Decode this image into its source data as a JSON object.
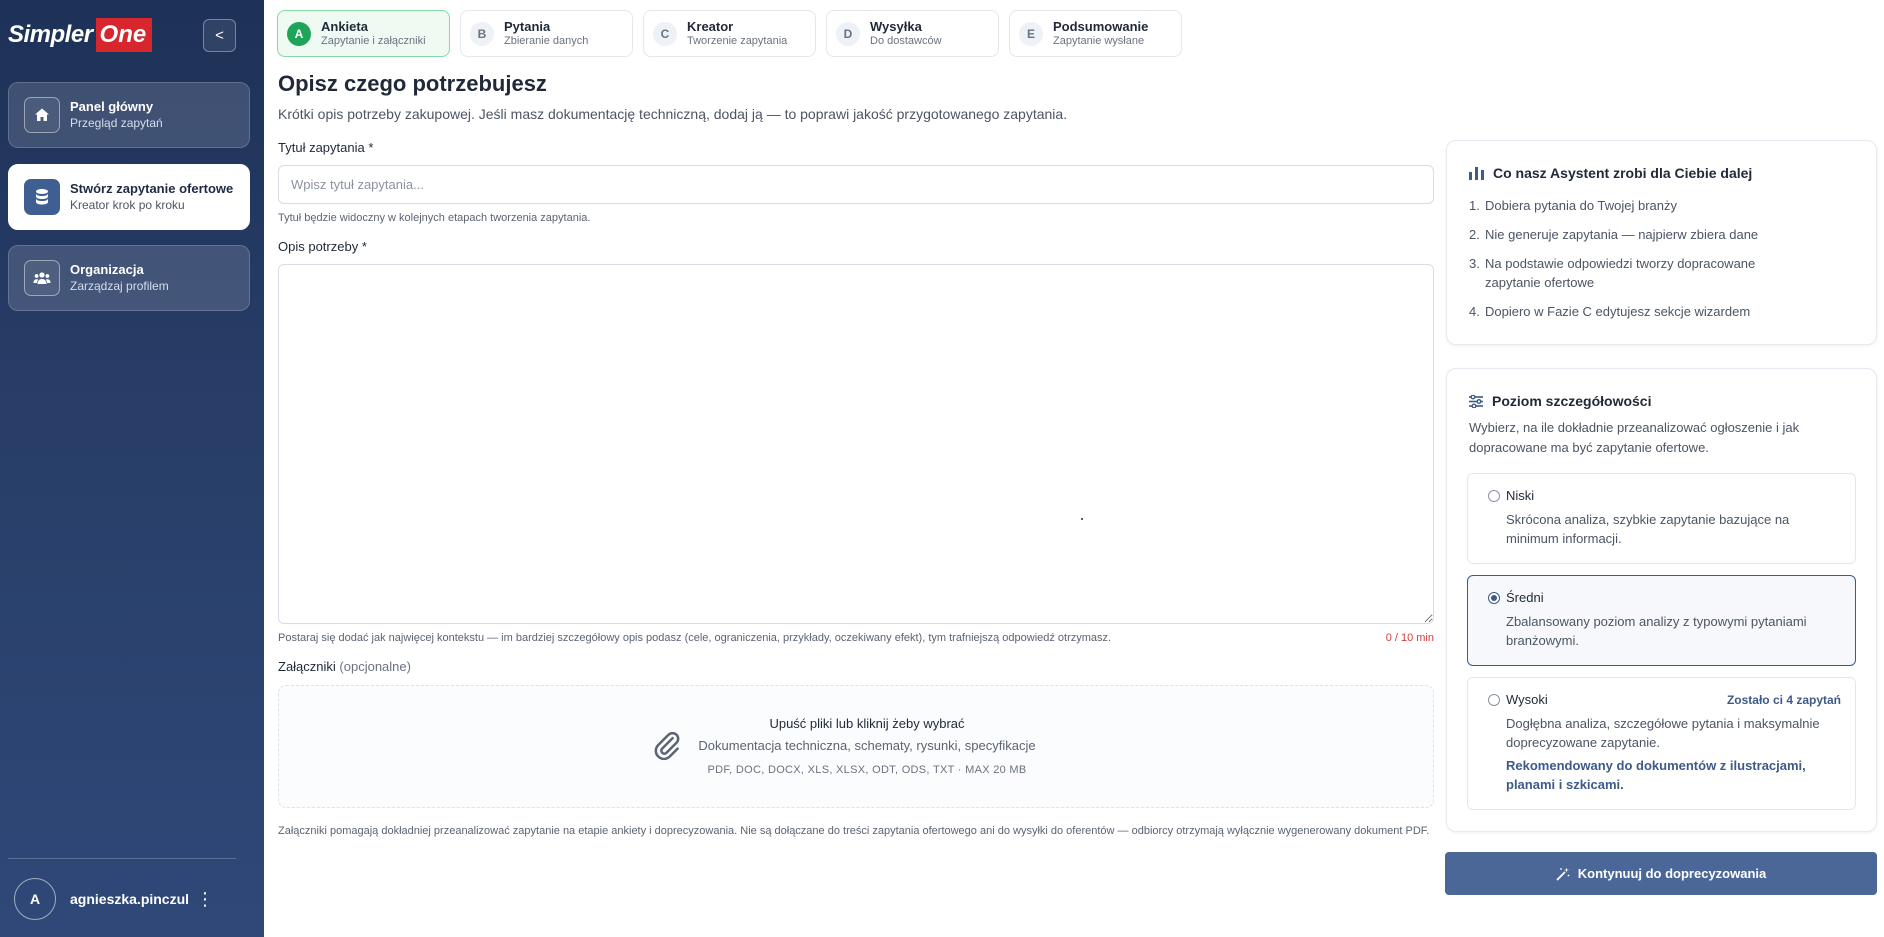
{
  "sidebar": {
    "logo_text": "Simpler",
    "logo_badge": "One",
    "collapse_label": "<",
    "items": [
      {
        "title": "Panel główny",
        "subtitle": "Przegląd zapytań"
      },
      {
        "title": "Stwórz zapytanie ofertowe",
        "subtitle": "Kreator krok po kroku"
      },
      {
        "title": "Organizacja",
        "subtitle": "Zarządzaj profilem"
      }
    ],
    "user": {
      "initial": "A",
      "name": "agnieszka.pinczuk@",
      "menu": "⋮"
    }
  },
  "steps": [
    {
      "letter": "A",
      "title": "Ankieta",
      "subtitle": "Zapytanie i załączniki"
    },
    {
      "letter": "B",
      "title": "Pytania",
      "subtitle": "Zbieranie danych"
    },
    {
      "letter": "C",
      "title": "Kreator",
      "subtitle": "Tworzenie zapytania"
    },
    {
      "letter": "D",
      "title": "Wysyłka",
      "subtitle": "Do dostawców"
    },
    {
      "letter": "E",
      "title": "Podsumowanie",
      "subtitle": "Zapytanie wysłane"
    }
  ],
  "main": {
    "title": "Opisz czego potrzebujesz",
    "description": "Krótki opis potrzeby zakupowej. Jeśli masz dokumentację techniczną, dodaj ją — to poprawi jakość przygotowanego zapytania.",
    "title_field": {
      "label": "Tytuł zapytania *",
      "placeholder": "Wpisz tytuł zapytania...",
      "value": "",
      "hint": "Tytuł będzie widoczny w kolejnych etapach tworzenia zapytania."
    },
    "need_field": {
      "label": "Opis potrzeby *",
      "value": "",
      "hint": "Postaraj się dodać jak najwięcej kontekstu — im bardziej szczegółowy opis podasz (cele, ograniczenia, przykłady, oczekiwany efekt), tym trafniejszą odpowiedź otrzymasz.",
      "counter": "0 / 10 min"
    },
    "attachments": {
      "label": "Załączniki",
      "optional": "(opcjonalne)",
      "drop_title": "Upuść pliki lub kliknij żeby wybrać",
      "drop_subtitle": "Dokumentacja techniczna, schematy, rysunki, specyfikacje",
      "formats": "PDF, DOC, DOCX, XLS, XLSX, ODT, ODS, TXT · MAX 20 MB"
    },
    "footnote": "Załączniki pomagają dokładniej przeanalizować zapytanie na etapie ankiety i doprecyzowania. Nie są dołączane do treści zapytania ofertowego ani do wysyłki do oferentów — odbiorcy otrzymają wyłącznie wygenerowany dokument PDF."
  },
  "assistant": {
    "title": "Co nasz Asystent zrobi dla Ciebie dalej",
    "steps": [
      {
        "num": "1.",
        "text": "Dobiera pytania do Twojej branży"
      },
      {
        "num": "2.",
        "text": "Nie generuje zapytania — najpierw zbiera dane"
      },
      {
        "num": "3.",
        "text": "Na podstawie odpowiedzi tworzy dopracowane zapytanie ofertowe"
      },
      {
        "num": "4.",
        "text": "Dopiero w Fazie C edytujesz sekcje wizardem"
      }
    ]
  },
  "detail": {
    "title": "Poziom szczegółowości",
    "description": "Wybierz, na ile dokładnie przeanalizować ogłoszenie i jak dopracowane ma być zapytanie ofertowe.",
    "selected": "Średni",
    "options": [
      {
        "title": "Niski",
        "desc": "Skrócona analiza, szybkie zapytanie bazujące na minimum informacji."
      },
      {
        "title": "Średni",
        "desc": "Zbalansowany poziom analizy z typowymi pytaniami branżowymi."
      },
      {
        "title": "Wysoki",
        "desc": "Dogłębna analiza, szczegółowe pytania i maksymalnie doprecyzowane zapytanie.",
        "badge": "Zostało ci 4 zapytań",
        "recommendation": "Rekomendowany do dokumentów z ilustracjami, planami i szkicami."
      }
    ]
  },
  "continue_label": "Kontynuuj do doprecyzowania",
  "colors": {
    "sidebar_bg": "#283e68",
    "active_step": "#1fa45a",
    "accent": "#4a6797",
    "logo_red": "#d7262d",
    "counter_red": "#d23b3b"
  }
}
